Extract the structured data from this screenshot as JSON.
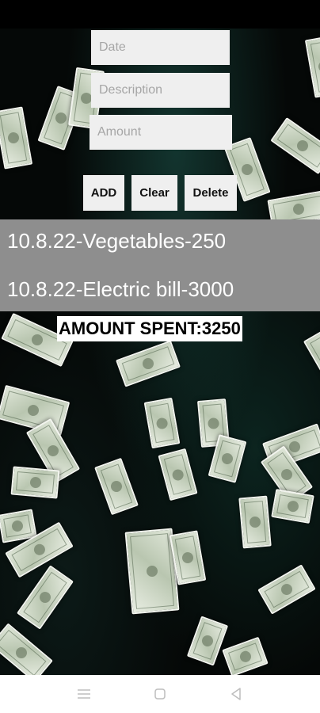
{
  "form": {
    "date_placeholder": "Date",
    "description_placeholder": "Description",
    "amount_placeholder": "Amount"
  },
  "buttons": {
    "add": "ADD",
    "clear": "Clear",
    "delete": "Delete"
  },
  "expenses": [
    "10.8.22-Vegetables-250",
    "10.8.22-Electric bill-3000"
  ],
  "total_label": "AMOUNT SPENT:3250",
  "navigation": {
    "menu_icon": "menu-icon",
    "home_icon": "home-icon",
    "back_icon": "back-icon"
  },
  "colors": {
    "list_background": "#8e8e8e",
    "input_background": "#efefef",
    "nav_background": "#ffffff"
  }
}
